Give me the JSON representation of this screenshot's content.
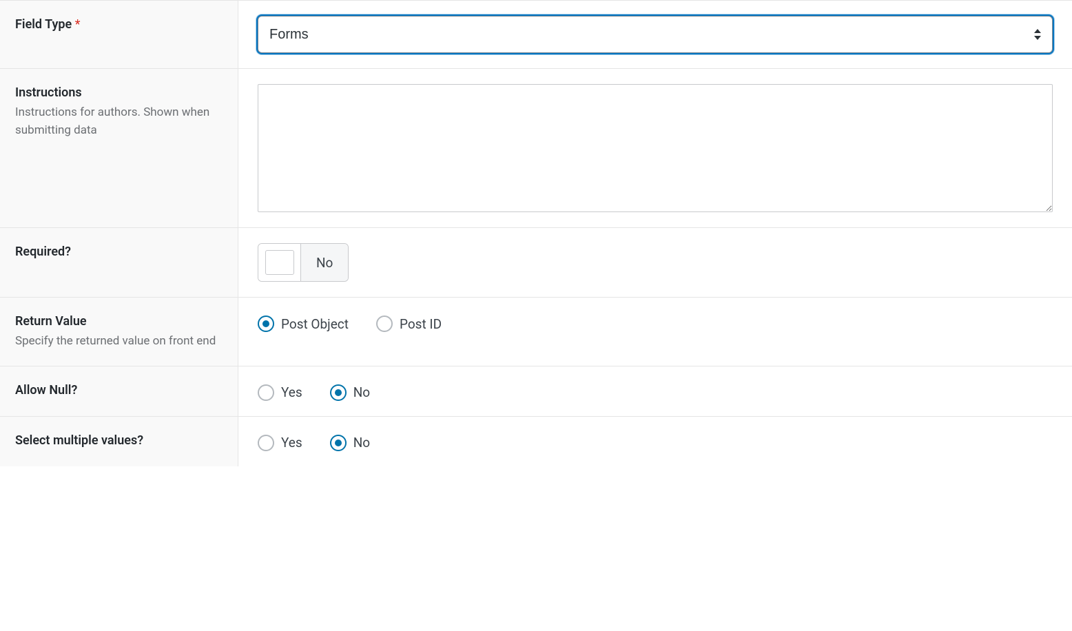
{
  "fields": {
    "field_type": {
      "label": "Field Type",
      "required_marker": "*",
      "selected": "Forms"
    },
    "instructions": {
      "label": "Instructions",
      "desc": "Instructions for authors. Shown when submitting data",
      "value": ""
    },
    "required": {
      "label": "Required?",
      "toggle_label": "No"
    },
    "return_value": {
      "label": "Return Value",
      "desc": "Specify the returned value on front end",
      "options": {
        "post_object": "Post Object",
        "post_id": "Post ID"
      },
      "selected": "post_object"
    },
    "allow_null": {
      "label": "Allow Null?",
      "options": {
        "yes": "Yes",
        "no": "No"
      },
      "selected": "no"
    },
    "select_multiple": {
      "label": "Select multiple values?",
      "options": {
        "yes": "Yes",
        "no": "No"
      },
      "selected": "no"
    }
  }
}
